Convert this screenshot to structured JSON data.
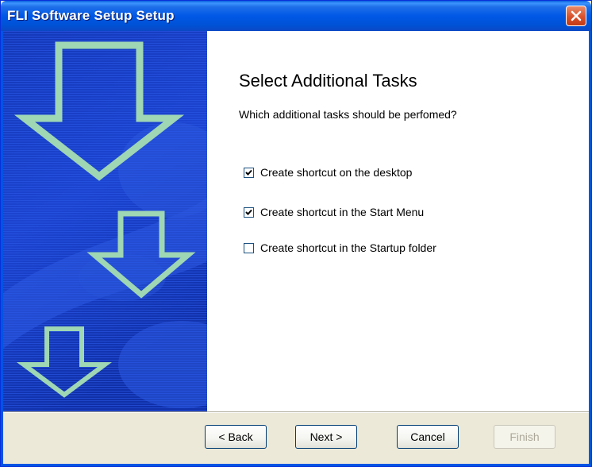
{
  "window": {
    "title": "FLI Software Setup Setup"
  },
  "page": {
    "heading": "Select Additional Tasks",
    "subtext": "Which additional tasks should be perfomed?"
  },
  "tasks": [
    {
      "label": "Create shortcut on the desktop",
      "checked": true
    },
    {
      "label": "Create shortcut in the Start Menu",
      "checked": true
    },
    {
      "label": "Create shortcut in the Startup folder",
      "checked": false
    }
  ],
  "buttons": {
    "back": "< Back",
    "next": "Next >",
    "cancel": "Cancel",
    "finish": "Finish"
  },
  "colors": {
    "banner_blue": "#1a3cc8",
    "title_blue": "#0058e6",
    "arrow_green": "#9fd6b3"
  }
}
